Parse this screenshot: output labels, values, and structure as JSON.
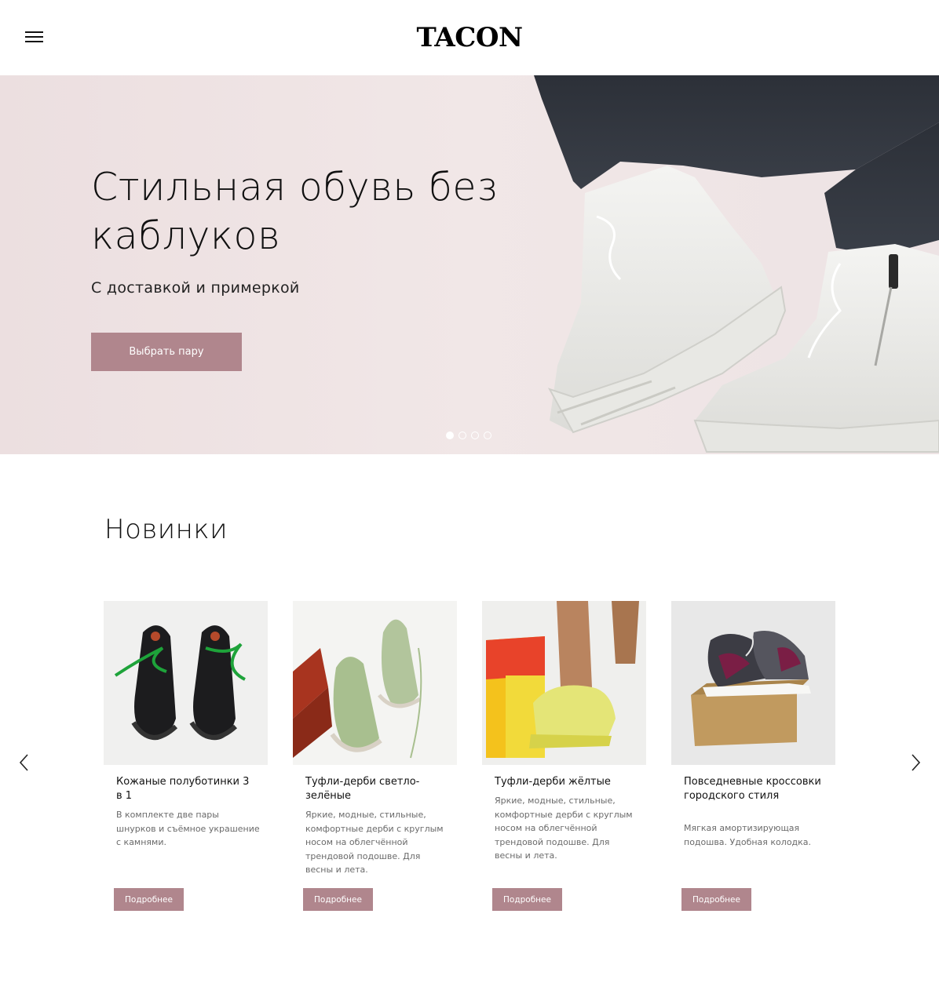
{
  "header": {
    "logo": "TACON",
    "menu_icon": "hamburger-menu-icon"
  },
  "hero": {
    "title": "Стильная обувь без каблуков",
    "subtitle": "С доставкой и примеркой",
    "button_label": "Выбрать пару",
    "slides_total": 4,
    "active_slide": 1
  },
  "new_section": {
    "title": "Новинки",
    "prev_icon": "chevron-left-icon",
    "next_icon": "chevron-right-icon",
    "products": [
      {
        "name": "Кожаные полуботинки 3 в 1",
        "description": "В комплекте две пары шнурков и съёмное украшение с камнями.",
        "button": "Подробнее"
      },
      {
        "name": "Туфли-дерби светло-зелёные",
        "description": "Яркие, модные, стильные, комфортные дерби с круглым носом на облегчённой трендовой подошве. Для весны и лета.",
        "button": "Подробнее"
      },
      {
        "name": "Туфли-дерби жёлтые",
        "description": "Яркие, модные, стильные, комфортные дерби с круглым носом на облегчённой трендовой подошве. Для весны и лета.",
        "button": "Подробнее"
      },
      {
        "name": "Повседневные кроссовки городского стиля",
        "description": "Мягкая амортизирующая подошва. Удобная колодка.",
        "button": "Подробнее"
      }
    ]
  },
  "colors": {
    "accent": "#b0868d",
    "hero_bg": "#efe4e4"
  }
}
